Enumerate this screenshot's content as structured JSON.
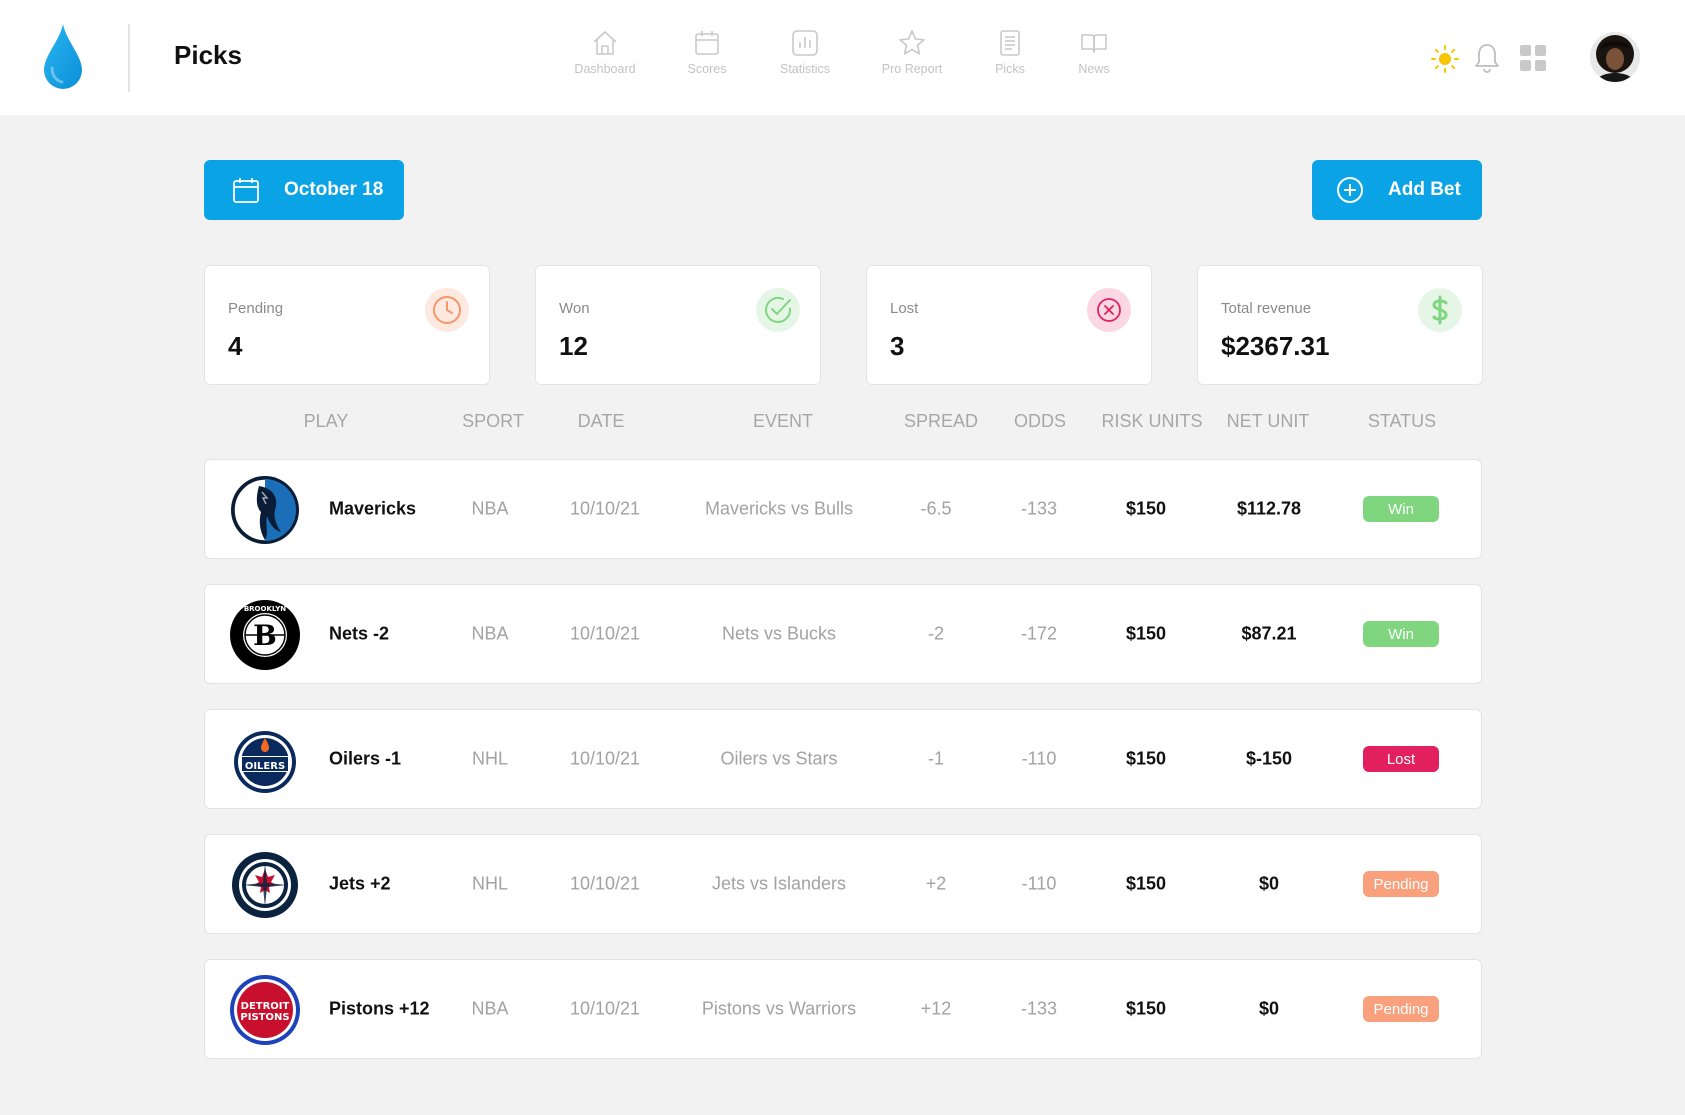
{
  "header": {
    "title": "Picks",
    "nav": [
      {
        "label": "Dashboard",
        "icon": "home-icon"
      },
      {
        "label": "Scores",
        "icon": "calendar-icon"
      },
      {
        "label": "Statistics",
        "icon": "bar-chart-icon"
      },
      {
        "label": "Pro Report",
        "icon": "star-icon"
      },
      {
        "label": "Picks",
        "icon": "document-icon"
      },
      {
        "label": "News",
        "icon": "book-icon"
      }
    ]
  },
  "toolbar": {
    "date_label": "October 18",
    "add_label": "Add Bet"
  },
  "stats": [
    {
      "label": "Pending",
      "value": "4",
      "icon": "clock-icon",
      "color": "#f5966b"
    },
    {
      "label": "Won",
      "value": "12",
      "icon": "check-circle-icon",
      "color": "#7fd67f"
    },
    {
      "label": "Lost",
      "value": "3",
      "icon": "x-circle-icon",
      "color": "#e3205f"
    },
    {
      "label": "Total revenue",
      "value": "$2367.31",
      "icon": "dollar-icon",
      "color": "#7fd67f"
    }
  ],
  "table": {
    "headers": [
      "PLAY",
      "SPORT",
      "DATE",
      "EVENT",
      "SPREAD",
      "ODDS",
      "RISK UNITS",
      "NET UNIT",
      "STATUS"
    ],
    "rows": [
      {
        "play": "Mavericks",
        "sport": "NBA",
        "date": "10/10/21",
        "event": "Mavericks vs Bulls",
        "spread": "-6.5",
        "odds": "-133",
        "risk": "$150",
        "net": "$112.78",
        "status": "Win",
        "logo": "mavericks-logo"
      },
      {
        "play": "Nets -2",
        "sport": "NBA",
        "date": "10/10/21",
        "event": "Nets vs Bucks",
        "spread": "-2",
        "odds": "-172",
        "risk": "$150",
        "net": "$87.21",
        "status": "Win",
        "logo": "nets-logo"
      },
      {
        "play": "Oilers -1",
        "sport": "NHL",
        "date": "10/10/21",
        "event": "Oilers vs Stars",
        "spread": "-1",
        "odds": "-110",
        "risk": "$150",
        "net": "$-150",
        "status": "Lost",
        "logo": "oilers-logo"
      },
      {
        "play": "Jets +2",
        "sport": "NHL",
        "date": "10/10/21",
        "event": "Jets vs Islanders",
        "spread": "+2",
        "odds": "-110",
        "risk": "$150",
        "net": "$0",
        "status": "Pending",
        "logo": "jets-logo"
      },
      {
        "play": "Pistons +12",
        "sport": "NBA",
        "date": "10/10/21",
        "event": "Pistons vs Warriors",
        "spread": "+12",
        "odds": "-133",
        "risk": "$150",
        "net": "$0",
        "status": "Pending",
        "logo": "pistons-logo"
      }
    ]
  },
  "logo_text": {
    "nets_ring": "BROOKLYN",
    "nets_letter": "B",
    "oilers": "OILERS",
    "pistons_top": "DETROIT",
    "pistons_bottom": "PISTONS"
  },
  "colors": {
    "accent": "#0aa3e6",
    "win": "#7fd67f",
    "lost": "#e3205f",
    "pending": "#f9a07d"
  }
}
